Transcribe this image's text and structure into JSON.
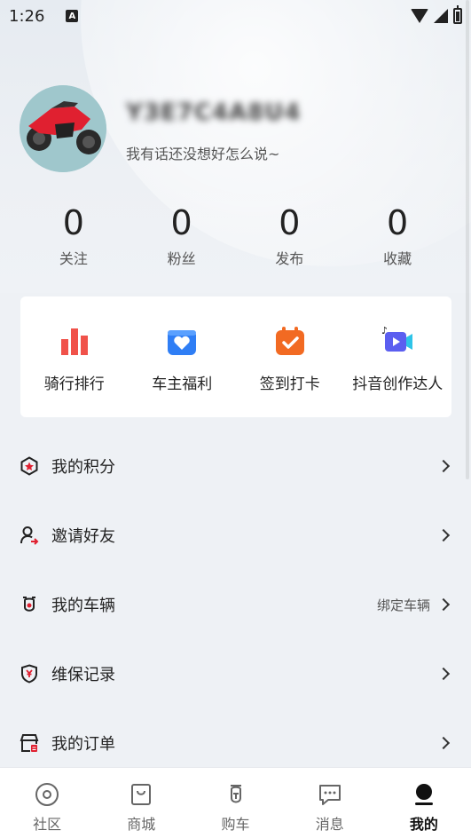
{
  "status_bar": {
    "time": "1:26",
    "notif_badge": "A"
  },
  "profile": {
    "username": "Y3E7C4A8U4",
    "bio": "我有话还没想好怎么说~"
  },
  "stats": [
    {
      "value": "0",
      "label": "关注"
    },
    {
      "value": "0",
      "label": "粉丝"
    },
    {
      "value": "0",
      "label": "发布"
    },
    {
      "value": "0",
      "label": "收藏"
    }
  ],
  "shortcuts": [
    {
      "label": "骑行排行",
      "icon": "bar-chart-icon",
      "color": "#f0524a"
    },
    {
      "label": "车主福利",
      "icon": "gift-heart-icon",
      "color": "#2f7ef5"
    },
    {
      "label": "签到打卡",
      "icon": "checkin-icon",
      "color": "#f26a22"
    },
    {
      "label": "抖音创作达人",
      "icon": "video-camera-icon",
      "color": "#5b5ef0"
    }
  ],
  "menu": [
    {
      "label": "我的积分",
      "icon": "points-hexagon-icon",
      "extra": ""
    },
    {
      "label": "邀请好友",
      "icon": "invite-user-icon",
      "extra": ""
    },
    {
      "label": "我的车辆",
      "icon": "motorcycle-icon",
      "extra": "绑定车辆"
    },
    {
      "label": "维保记录",
      "icon": "maintenance-shield-icon",
      "extra": ""
    },
    {
      "label": "我的订单",
      "icon": "order-store-icon",
      "extra": ""
    }
  ],
  "tabs": [
    {
      "label": "社区",
      "icon": "community-icon",
      "active": false
    },
    {
      "label": "商城",
      "icon": "shop-bag-icon",
      "active": false
    },
    {
      "label": "购车",
      "icon": "buy-scooter-icon",
      "active": false
    },
    {
      "label": "消息",
      "icon": "message-icon",
      "active": false
    },
    {
      "label": "我的",
      "icon": "profile-icon",
      "active": true
    }
  ],
  "colors": {
    "accent_red": "#e02030",
    "background": "#eef1f5"
  }
}
